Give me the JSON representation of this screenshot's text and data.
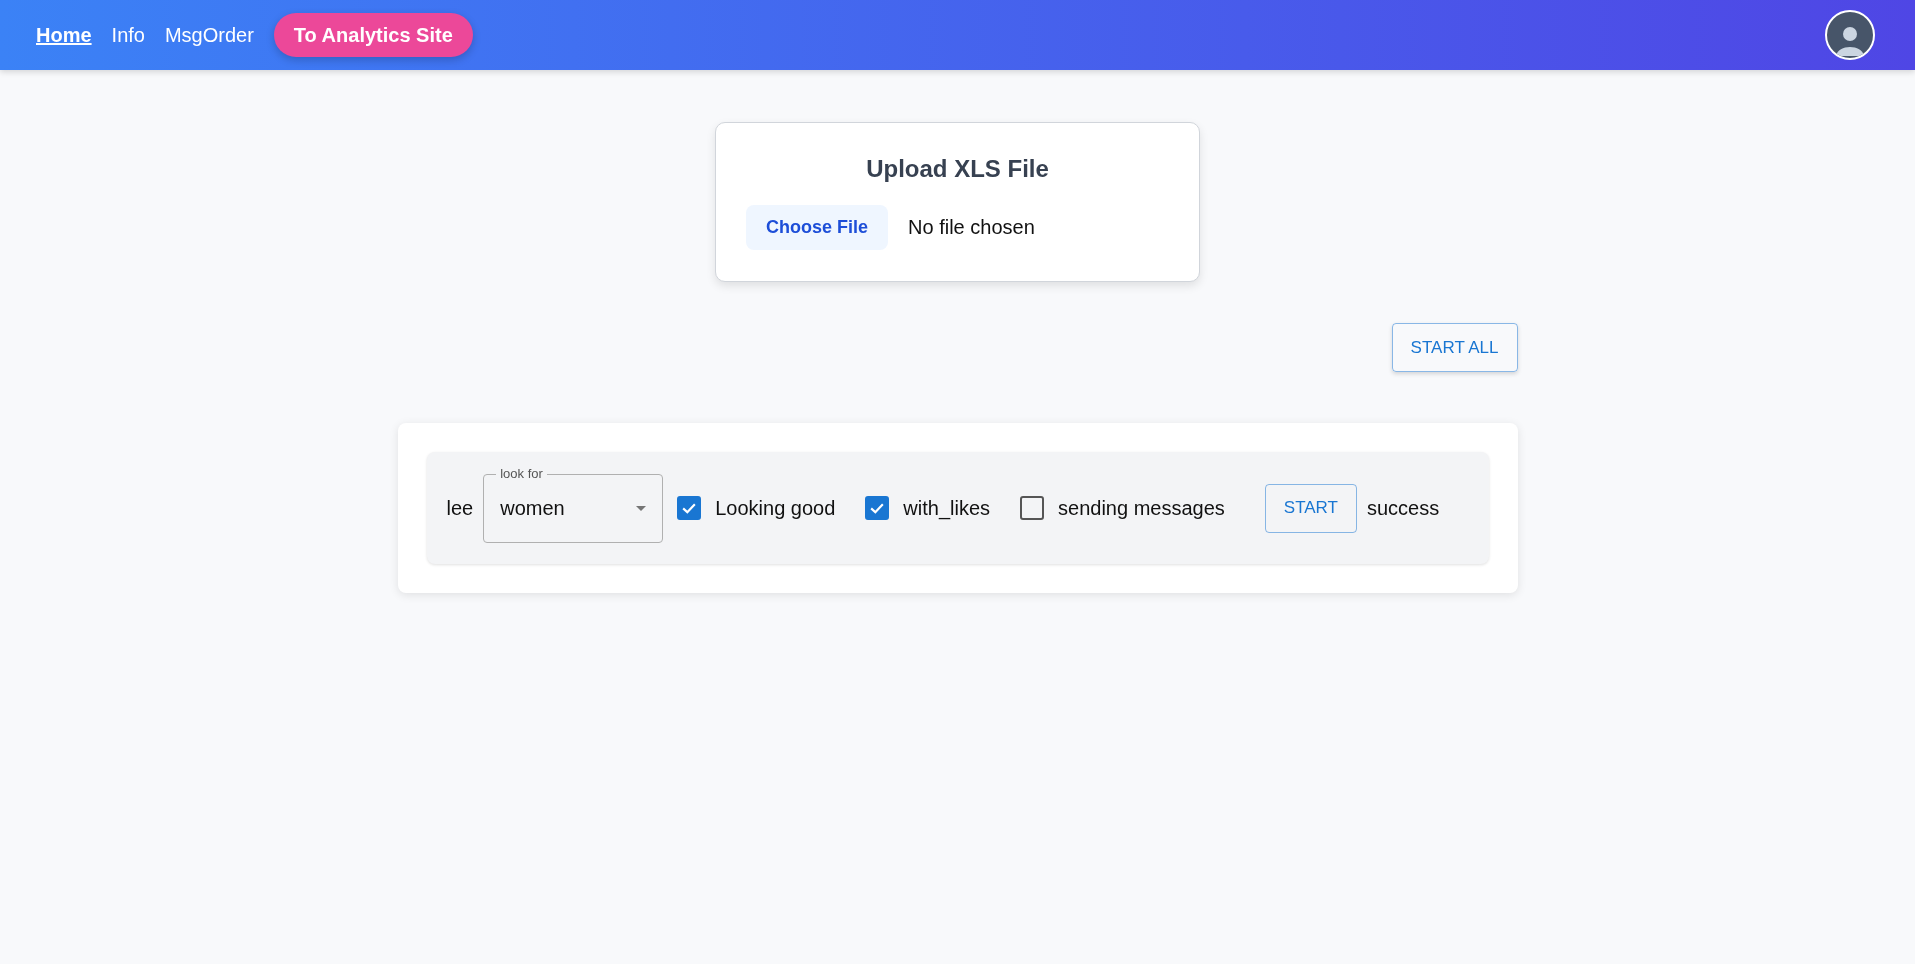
{
  "header": {
    "nav": [
      {
        "label": "Home",
        "selected": true
      },
      {
        "label": "Info",
        "selected": false
      },
      {
        "label": "MsgOrder",
        "selected": false
      }
    ],
    "cta": "To Analytics Site"
  },
  "upload": {
    "title": "Upload XLS File",
    "button": "Choose File",
    "status": "No file chosen"
  },
  "start_all": "START ALL",
  "tasks": [
    {
      "name": "lee",
      "look_for": {
        "label": "look for",
        "value": "women"
      },
      "options": [
        {
          "label": "Looking good",
          "checked": true
        },
        {
          "label": "with_likes",
          "checked": true
        },
        {
          "label": "sending messages",
          "checked": false
        }
      ],
      "start": "START",
      "status": "success"
    }
  ]
}
